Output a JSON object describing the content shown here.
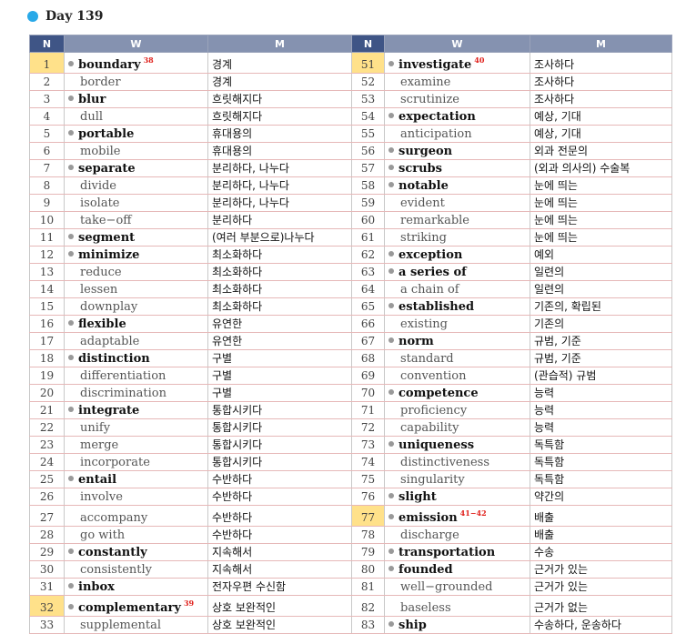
{
  "header": {
    "title": "Day  139"
  },
  "columns": {
    "n": "N",
    "w": "W",
    "m": "M"
  },
  "colors": {
    "header_bg": "#8592b0",
    "n_header_bg": "#3f5586",
    "highlight": "#ffe18a",
    "ref_color": "#e0201b",
    "dot_color": "#29a9e8"
  },
  "left": [
    {
      "n": "1",
      "w": "boundary",
      "m": "경계",
      "head": true,
      "hl": true,
      "ref": "38"
    },
    {
      "n": "2",
      "w": "border",
      "m": "경계",
      "head": false,
      "hl": false,
      "ref": ""
    },
    {
      "n": "3",
      "w": "blur",
      "m": "흐릿해지다",
      "head": true,
      "hl": false,
      "ref": ""
    },
    {
      "n": "4",
      "w": "dull",
      "m": "흐릿해지다",
      "head": false,
      "hl": false,
      "ref": ""
    },
    {
      "n": "5",
      "w": "portable",
      "m": "휴대용의",
      "head": true,
      "hl": false,
      "ref": ""
    },
    {
      "n": "6",
      "w": "mobile",
      "m": "휴대용의",
      "head": false,
      "hl": false,
      "ref": ""
    },
    {
      "n": "7",
      "w": "separate",
      "m": "분리하다, 나누다",
      "head": true,
      "hl": false,
      "ref": ""
    },
    {
      "n": "8",
      "w": "divide",
      "m": "분리하다, 나누다",
      "head": false,
      "hl": false,
      "ref": ""
    },
    {
      "n": "9",
      "w": "isolate",
      "m": "분리하다, 나누다",
      "head": false,
      "hl": false,
      "ref": ""
    },
    {
      "n": "10",
      "w": "take−off",
      "m": "분리하다",
      "head": false,
      "hl": false,
      "ref": ""
    },
    {
      "n": "11",
      "w": "segment",
      "m": "(여러 부분으로)나누다",
      "head": true,
      "hl": false,
      "ref": ""
    },
    {
      "n": "12",
      "w": "minimize",
      "m": "최소화하다",
      "head": true,
      "hl": false,
      "ref": ""
    },
    {
      "n": "13",
      "w": "reduce",
      "m": "최소화하다",
      "head": false,
      "hl": false,
      "ref": ""
    },
    {
      "n": "14",
      "w": "lessen",
      "m": "최소화하다",
      "head": false,
      "hl": false,
      "ref": ""
    },
    {
      "n": "15",
      "w": "downplay",
      "m": "최소화하다",
      "head": false,
      "hl": false,
      "ref": ""
    },
    {
      "n": "16",
      "w": "flexible",
      "m": "유연한",
      "head": true,
      "hl": false,
      "ref": ""
    },
    {
      "n": "17",
      "w": "adaptable",
      "m": "유연한",
      "head": false,
      "hl": false,
      "ref": ""
    },
    {
      "n": "18",
      "w": "distinction",
      "m": "구별",
      "head": true,
      "hl": false,
      "ref": ""
    },
    {
      "n": "19",
      "w": "differentiation",
      "m": "구별",
      "head": false,
      "hl": false,
      "ref": ""
    },
    {
      "n": "20",
      "w": "discrimination",
      "m": "구별",
      "head": false,
      "hl": false,
      "ref": ""
    },
    {
      "n": "21",
      "w": "integrate",
      "m": "통합시키다",
      "head": true,
      "hl": false,
      "ref": ""
    },
    {
      "n": "22",
      "w": "unify",
      "m": "통합시키다",
      "head": false,
      "hl": false,
      "ref": ""
    },
    {
      "n": "23",
      "w": "merge",
      "m": "통합시키다",
      "head": false,
      "hl": false,
      "ref": ""
    },
    {
      "n": "24",
      "w": "incorporate",
      "m": "통합시키다",
      "head": false,
      "hl": false,
      "ref": ""
    },
    {
      "n": "25",
      "w": "entail",
      "m": "수반하다",
      "head": true,
      "hl": false,
      "ref": ""
    },
    {
      "n": "26",
      "w": "involve",
      "m": "수반하다",
      "head": false,
      "hl": false,
      "ref": ""
    },
    {
      "n": "27",
      "w": "accompany",
      "m": "수반하다",
      "head": false,
      "hl": false,
      "ref": ""
    },
    {
      "n": "28",
      "w": "go with",
      "m": "수반하다",
      "head": false,
      "hl": false,
      "ref": ""
    },
    {
      "n": "29",
      "w": "constantly",
      "m": "지속해서",
      "head": true,
      "hl": false,
      "ref": ""
    },
    {
      "n": "30",
      "w": "consistently",
      "m": "지속해서",
      "head": false,
      "hl": false,
      "ref": ""
    },
    {
      "n": "31",
      "w": "inbox",
      "m": "전자우편 수신함",
      "head": true,
      "hl": false,
      "ref": ""
    },
    {
      "n": "32",
      "w": "complementary",
      "m": "상호 보완적인",
      "head": true,
      "hl": true,
      "ref": "39"
    },
    {
      "n": "33",
      "w": "supplemental",
      "m": "상호 보완적인",
      "head": false,
      "hl": false,
      "ref": ""
    }
  ],
  "right": [
    {
      "n": "51",
      "w": "investigate",
      "m": "조사하다",
      "head": true,
      "hl": true,
      "ref": "40"
    },
    {
      "n": "52",
      "w": "examine",
      "m": "조사하다",
      "head": false,
      "hl": false,
      "ref": ""
    },
    {
      "n": "53",
      "w": "scrutinize",
      "m": "조사하다",
      "head": false,
      "hl": false,
      "ref": ""
    },
    {
      "n": "54",
      "w": "expectation",
      "m": "예상, 기대",
      "head": true,
      "hl": false,
      "ref": ""
    },
    {
      "n": "55",
      "w": "anticipation",
      "m": "예상, 기대",
      "head": false,
      "hl": false,
      "ref": ""
    },
    {
      "n": "56",
      "w": "surgeon",
      "m": "외과 전문의",
      "head": true,
      "hl": false,
      "ref": ""
    },
    {
      "n": "57",
      "w": "scrubs",
      "m": "(외과 의사의) 수술복",
      "head": true,
      "hl": false,
      "ref": ""
    },
    {
      "n": "58",
      "w": "notable",
      "m": "눈에 띄는",
      "head": true,
      "hl": false,
      "ref": ""
    },
    {
      "n": "59",
      "w": "evident",
      "m": "눈에 띄는",
      "head": false,
      "hl": false,
      "ref": ""
    },
    {
      "n": "60",
      "w": "remarkable",
      "m": "눈에 띄는",
      "head": false,
      "hl": false,
      "ref": ""
    },
    {
      "n": "61",
      "w": "striking",
      "m": "눈에 띄는",
      "head": false,
      "hl": false,
      "ref": ""
    },
    {
      "n": "62",
      "w": "exception",
      "m": "예외",
      "head": true,
      "hl": false,
      "ref": ""
    },
    {
      "n": "63",
      "w": "a series of",
      "m": "일련의",
      "head": true,
      "hl": false,
      "ref": ""
    },
    {
      "n": "64",
      "w": "a chain of",
      "m": "일련의",
      "head": false,
      "hl": false,
      "ref": ""
    },
    {
      "n": "65",
      "w": "established",
      "m": "기존의, 확립된",
      "head": true,
      "hl": false,
      "ref": ""
    },
    {
      "n": "66",
      "w": "existing",
      "m": "기존의",
      "head": false,
      "hl": false,
      "ref": ""
    },
    {
      "n": "67",
      "w": "norm",
      "m": "규범, 기준",
      "head": true,
      "hl": false,
      "ref": ""
    },
    {
      "n": "68",
      "w": "standard",
      "m": "규범, 기준",
      "head": false,
      "hl": false,
      "ref": ""
    },
    {
      "n": "69",
      "w": "convention",
      "m": "(관습적) 규범",
      "head": false,
      "hl": false,
      "ref": ""
    },
    {
      "n": "70",
      "w": "competence",
      "m": "능력",
      "head": true,
      "hl": false,
      "ref": ""
    },
    {
      "n": "71",
      "w": "proficiency",
      "m": "능력",
      "head": false,
      "hl": false,
      "ref": ""
    },
    {
      "n": "72",
      "w": "capability",
      "m": "능력",
      "head": false,
      "hl": false,
      "ref": ""
    },
    {
      "n": "73",
      "w": "uniqueness",
      "m": "독특함",
      "head": true,
      "hl": false,
      "ref": ""
    },
    {
      "n": "74",
      "w": "distinctiveness",
      "m": "독특함",
      "head": false,
      "hl": false,
      "ref": ""
    },
    {
      "n": "75",
      "w": "singularity",
      "m": "독특함",
      "head": false,
      "hl": false,
      "ref": ""
    },
    {
      "n": "76",
      "w": "slight",
      "m": "약간의",
      "head": true,
      "hl": false,
      "ref": ""
    },
    {
      "n": "77",
      "w": "emission",
      "m": "배출",
      "head": true,
      "hl": true,
      "ref": "41−42"
    },
    {
      "n": "78",
      "w": "discharge",
      "m": "배출",
      "head": false,
      "hl": false,
      "ref": ""
    },
    {
      "n": "79",
      "w": "transportation",
      "m": "수송",
      "head": true,
      "hl": false,
      "ref": ""
    },
    {
      "n": "80",
      "w": "founded",
      "m": "근거가 있는",
      "head": true,
      "hl": false,
      "ref": ""
    },
    {
      "n": "81",
      "w": "well−grounded",
      "m": "근거가 있는",
      "head": false,
      "hl": false,
      "ref": ""
    },
    {
      "n": "82",
      "w": "baseless",
      "m": "근거가 없는",
      "head": false,
      "hl": false,
      "ref": ""
    },
    {
      "n": "83",
      "w": "ship",
      "m": "수송하다, 운송하다",
      "head": true,
      "hl": false,
      "ref": ""
    }
  ]
}
